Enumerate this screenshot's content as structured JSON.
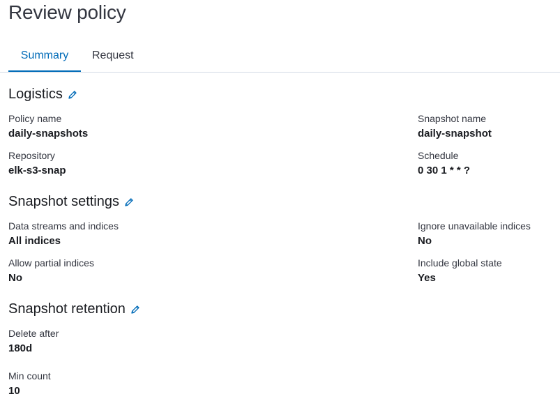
{
  "page": {
    "title": "Review policy"
  },
  "tabs": [
    {
      "label": "Summary",
      "active": true
    },
    {
      "label": "Request",
      "active": false
    }
  ],
  "logistics": {
    "title": "Logistics",
    "policy_name_label": "Policy name",
    "policy_name_value": "daily-snapshots",
    "snapshot_name_label": "Snapshot name",
    "snapshot_name_value": "daily-snapshot",
    "repository_label": "Repository",
    "repository_value": "elk-s3-snap",
    "schedule_label": "Schedule",
    "schedule_value": "0 30 1 * * ?"
  },
  "snapshot_settings": {
    "title": "Snapshot settings",
    "data_streams_label": "Data streams and indices",
    "data_streams_value": "All indices",
    "ignore_unavailable_label": "Ignore unavailable indices",
    "ignore_unavailable_value": "No",
    "allow_partial_label": "Allow partial indices",
    "allow_partial_value": "No",
    "include_global_label": "Include global state",
    "include_global_value": "Yes"
  },
  "snapshot_retention": {
    "title": "Snapshot retention",
    "delete_after_label": "Delete after",
    "delete_after_value": "180d",
    "min_count_label": "Min count",
    "min_count_value": "10"
  },
  "colors": {
    "accent": "#006bb8",
    "text": "#1a1c21",
    "border": "#d3dae6"
  },
  "icons": {
    "edit": "pencil-icon"
  }
}
